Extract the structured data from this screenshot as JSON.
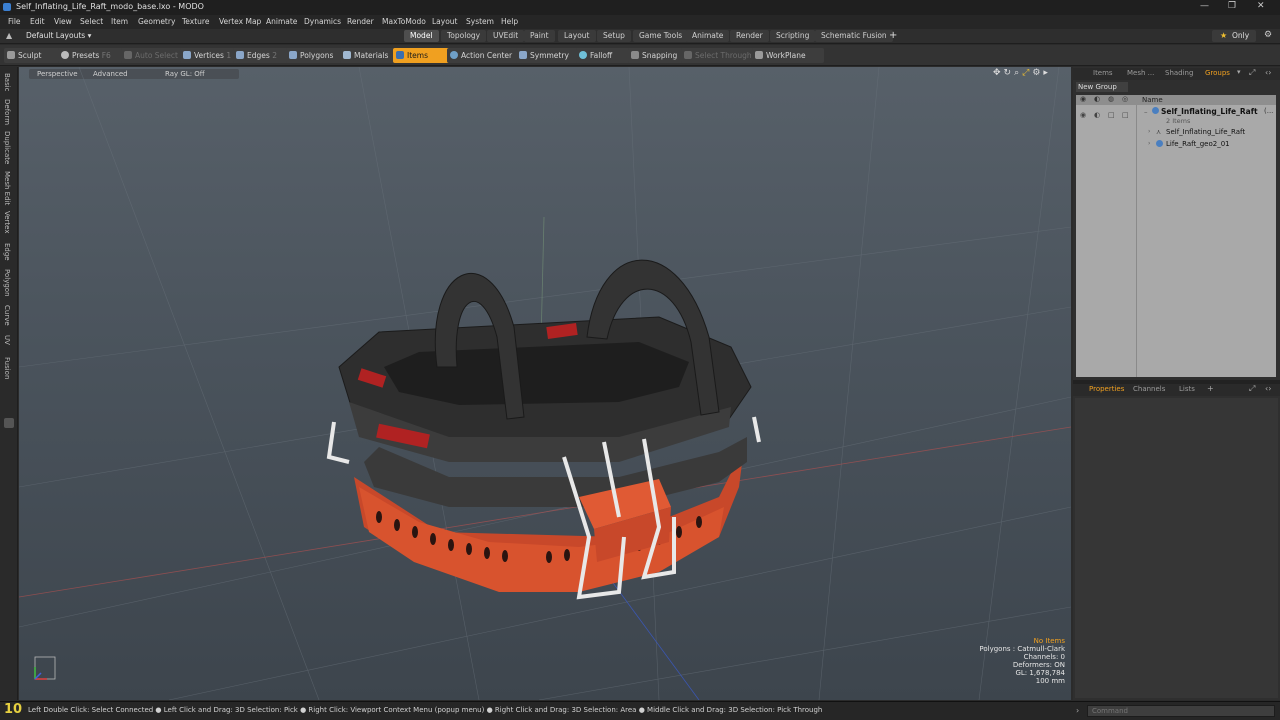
{
  "window": {
    "title": "Self_Inflating_Life_Raft_modo_base.lxo - MODO",
    "minimize": "—",
    "maximize": "❐",
    "close": "✕"
  },
  "menu": [
    "File",
    "Edit",
    "View",
    "Select",
    "Item",
    "Geometry",
    "Texture",
    "Vertex Map",
    "Animate",
    "Dynamics",
    "Render",
    "MaxToModo",
    "Layout",
    "System",
    "Help"
  ],
  "layout": {
    "selector": "Default Layouts ▾",
    "tabs": [
      "Model",
      "Topology",
      "UVEdit",
      "Paint",
      "Layout",
      "Setup",
      "Game Tools",
      "Animate",
      "Render",
      "Scripting",
      "Schematic Fusion"
    ],
    "active_tab": "Model",
    "plus": "+",
    "only": "Only",
    "gear": "⚙"
  },
  "toolbar": {
    "sculpt": "Sculpt",
    "presets": "Presets",
    "presets_key": "F6",
    "auto_select": "Auto Select",
    "vertices": "Vertices",
    "vertices_count": "1",
    "edges": "Edges",
    "edges_count": "2",
    "polygons": "Polygons",
    "materials": "Materials",
    "items": "Items",
    "action_center": "Action Center",
    "symmetry": "Symmetry",
    "falloff": "Falloff",
    "snapping": "Snapping",
    "select_through": "Select Through",
    "workplane": "WorkPlane"
  },
  "left_tabs": [
    "Basic",
    "Deform",
    "Duplicate",
    "Mesh Edit",
    "Vertex",
    "Edge",
    "Polygon",
    "Curve",
    "UV",
    "Fusion"
  ],
  "viewport": {
    "view": "Perspective",
    "shading": "Advanced",
    "raygl": "Ray GL: Off",
    "hud": {
      "no_items": "No Items",
      "polygons": "Polygons : Catmull-Clark",
      "channels": "Channels: 0",
      "deformers": "Deformers: ON",
      "gl": "GL: 1,678,784",
      "scale": "100 mm"
    },
    "colors": {
      "raft_orange": "#d8532e",
      "tube_dark": "#2e2e2e",
      "accent": "#f0a020"
    }
  },
  "groups_panel": {
    "tabs": [
      "Items",
      "Mesh ...",
      "Shading",
      "Groups"
    ],
    "active_tab": "Groups",
    "new_group": "New Group",
    "col_name": "Name",
    "group_name": "Self_Inflating_Life_Raft",
    "group_suffix": "(...",
    "group_count": "2 Items",
    "children": [
      "Self_Inflating_Life_Raft",
      "Life_Raft_geo2_01"
    ]
  },
  "properties_panel": {
    "tabs": [
      "Properties",
      "Channels",
      "Lists"
    ],
    "active_tab": "Properties",
    "plus": "+"
  },
  "status": {
    "frame": "10",
    "hint": "Left Double Click: Select Connected ● Left Click and Drag: 3D Selection: Pick ● Right Click: Viewport Context Menu (popup menu) ● Right Click and Drag: 3D Selection: Area ● Middle Click and Drag: 3D Selection: Pick Through",
    "command_placeholder": "Command"
  }
}
